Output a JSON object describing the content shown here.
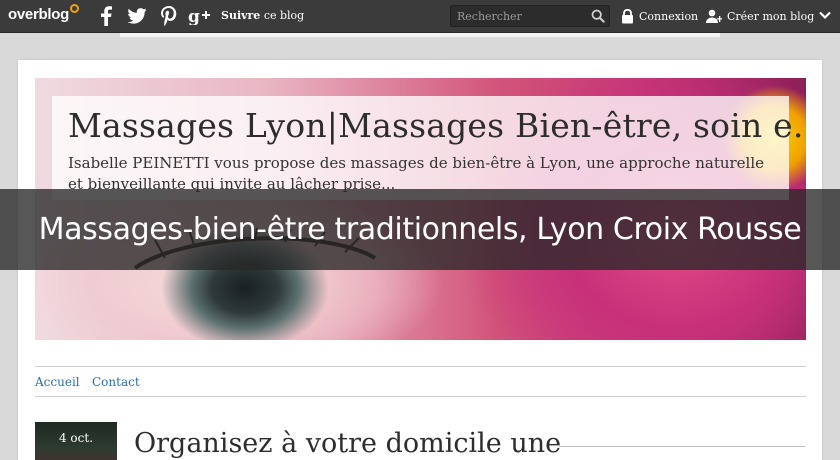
{
  "topbar": {
    "logo_text": "overblog",
    "social": [
      "facebook-icon",
      "twitter-icon",
      "pinterest-icon",
      "google-plus-icon"
    ],
    "follow_strong": "Suivre",
    "follow_rest": "ce blog",
    "search_placeholder": "Rechercher",
    "login_label": "Connexion",
    "create_label": "Créer mon blog"
  },
  "banner": {
    "title": "Massages Lyon|Massages Bien-être, soin e..",
    "description": "Isabelle PEINETTI vous propose des massages de bien-être à Lyon, une approche naturelle et bienveillante qui invite au lâcher prise..."
  },
  "overlay_title": "Massages-bien-être traditionnels, Lyon Croix Rousse",
  "nav": {
    "items": [
      "Accueil",
      "Contact"
    ]
  },
  "post": {
    "date": "4 oct.",
    "title": "Organisez à votre domicile une"
  },
  "colors": {
    "topbar": "#3b3b3b",
    "link": "#2a6fa8",
    "logo_accent": "#f0a30a"
  }
}
